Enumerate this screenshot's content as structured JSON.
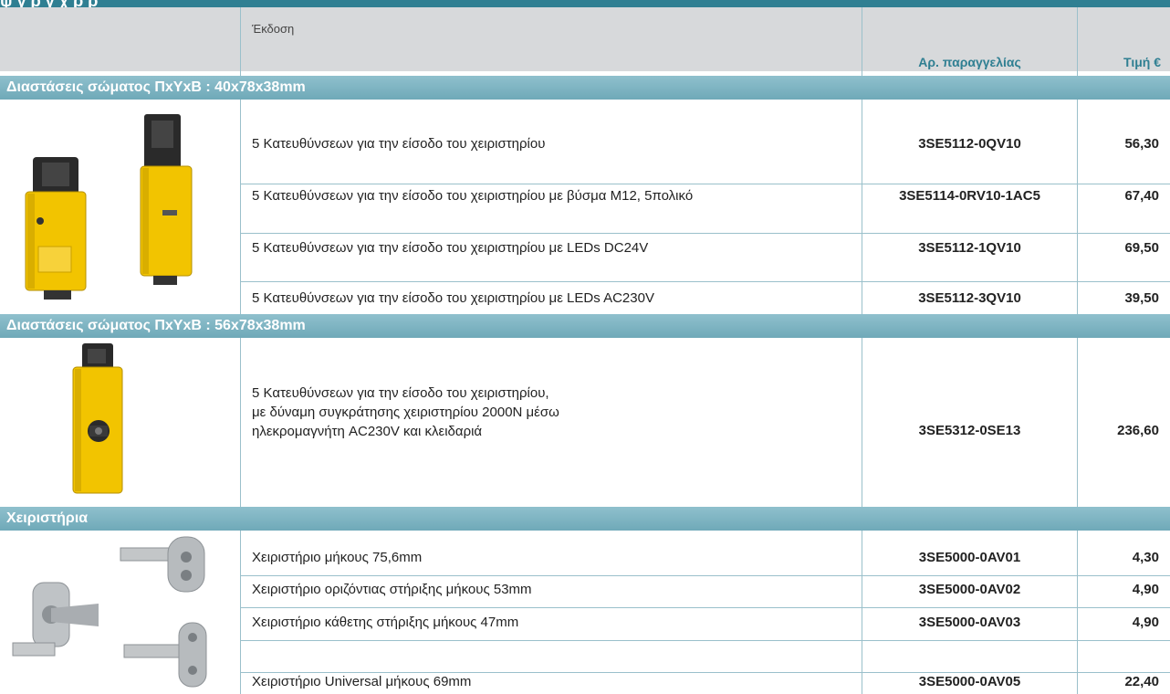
{
  "header": {
    "top_fragment": "ψ                      γ  ρ                          γ                χ   ρ    ρ",
    "edition_label": "Έκδοση",
    "order_label": "Αρ. παραγγελίας",
    "price_label": "Τιμή €"
  },
  "sections": [
    {
      "title": "Διαστάσεις σώματος ΠxΥxΒ : 40x78x38mm",
      "rows": [
        {
          "desc": "5 Κατευθύνσεων για την είσοδο του χειριστηρίου",
          "code": "3SE5112-0QV10",
          "price": "56,30"
        },
        {
          "desc": "5 Κατευθύνσεων για την είσοδο του χειριστηρίου με βύσμα M12, 5πολικό",
          "code": "3SE5114-0RV10-1AC5",
          "price": "67,40"
        },
        {
          "desc": "5 Κατευθύνσεων για την είσοδο του χειριστηρίου με LEDs DC24V",
          "code": "3SE5112-1QV10",
          "price": "69,50"
        },
        {
          "desc": "5 Κατευθύνσεων για την είσοδο του χειριστηρίου με LEDs AC230V",
          "code": "3SE5112-3QV10",
          "price": "39,50"
        }
      ]
    },
    {
      "title": "Διαστάσεις σώματος ΠxΥxΒ : 56x78x38mm",
      "rows": [
        {
          "desc_lines": [
            "5 Κατευθύνσεων για την είσοδο του χειριστηρίου,",
            "με δύναμη συγκράτησης χειριστηρίου 2000N μέσω",
            "ηλεκρομαγνήτη AC230V και κλειδαριά"
          ],
          "code": "3SE5312-0SE13",
          "price": "236,60"
        }
      ]
    },
    {
      "title": "Χειριστήρια",
      "rows": [
        {
          "desc": "Χειριστήριο μήκους 75,6mm",
          "code": "3SE5000-0AV01",
          "price": "4,30"
        },
        {
          "desc": "Χειριστήριο οριζόντιας στήριξης μήκους 53mm",
          "code": "3SE5000-0AV02",
          "price": "4,90"
        },
        {
          "desc": "Χειριστήριο κάθετης στήριξης μήκους 47mm",
          "code": "3SE5000-0AV03",
          "price": "4,90"
        },
        {
          "desc": "Χειριστήριο Universal μήκους 69mm",
          "code": "3SE5000-0AV05",
          "price": "22,40"
        }
      ]
    }
  ]
}
